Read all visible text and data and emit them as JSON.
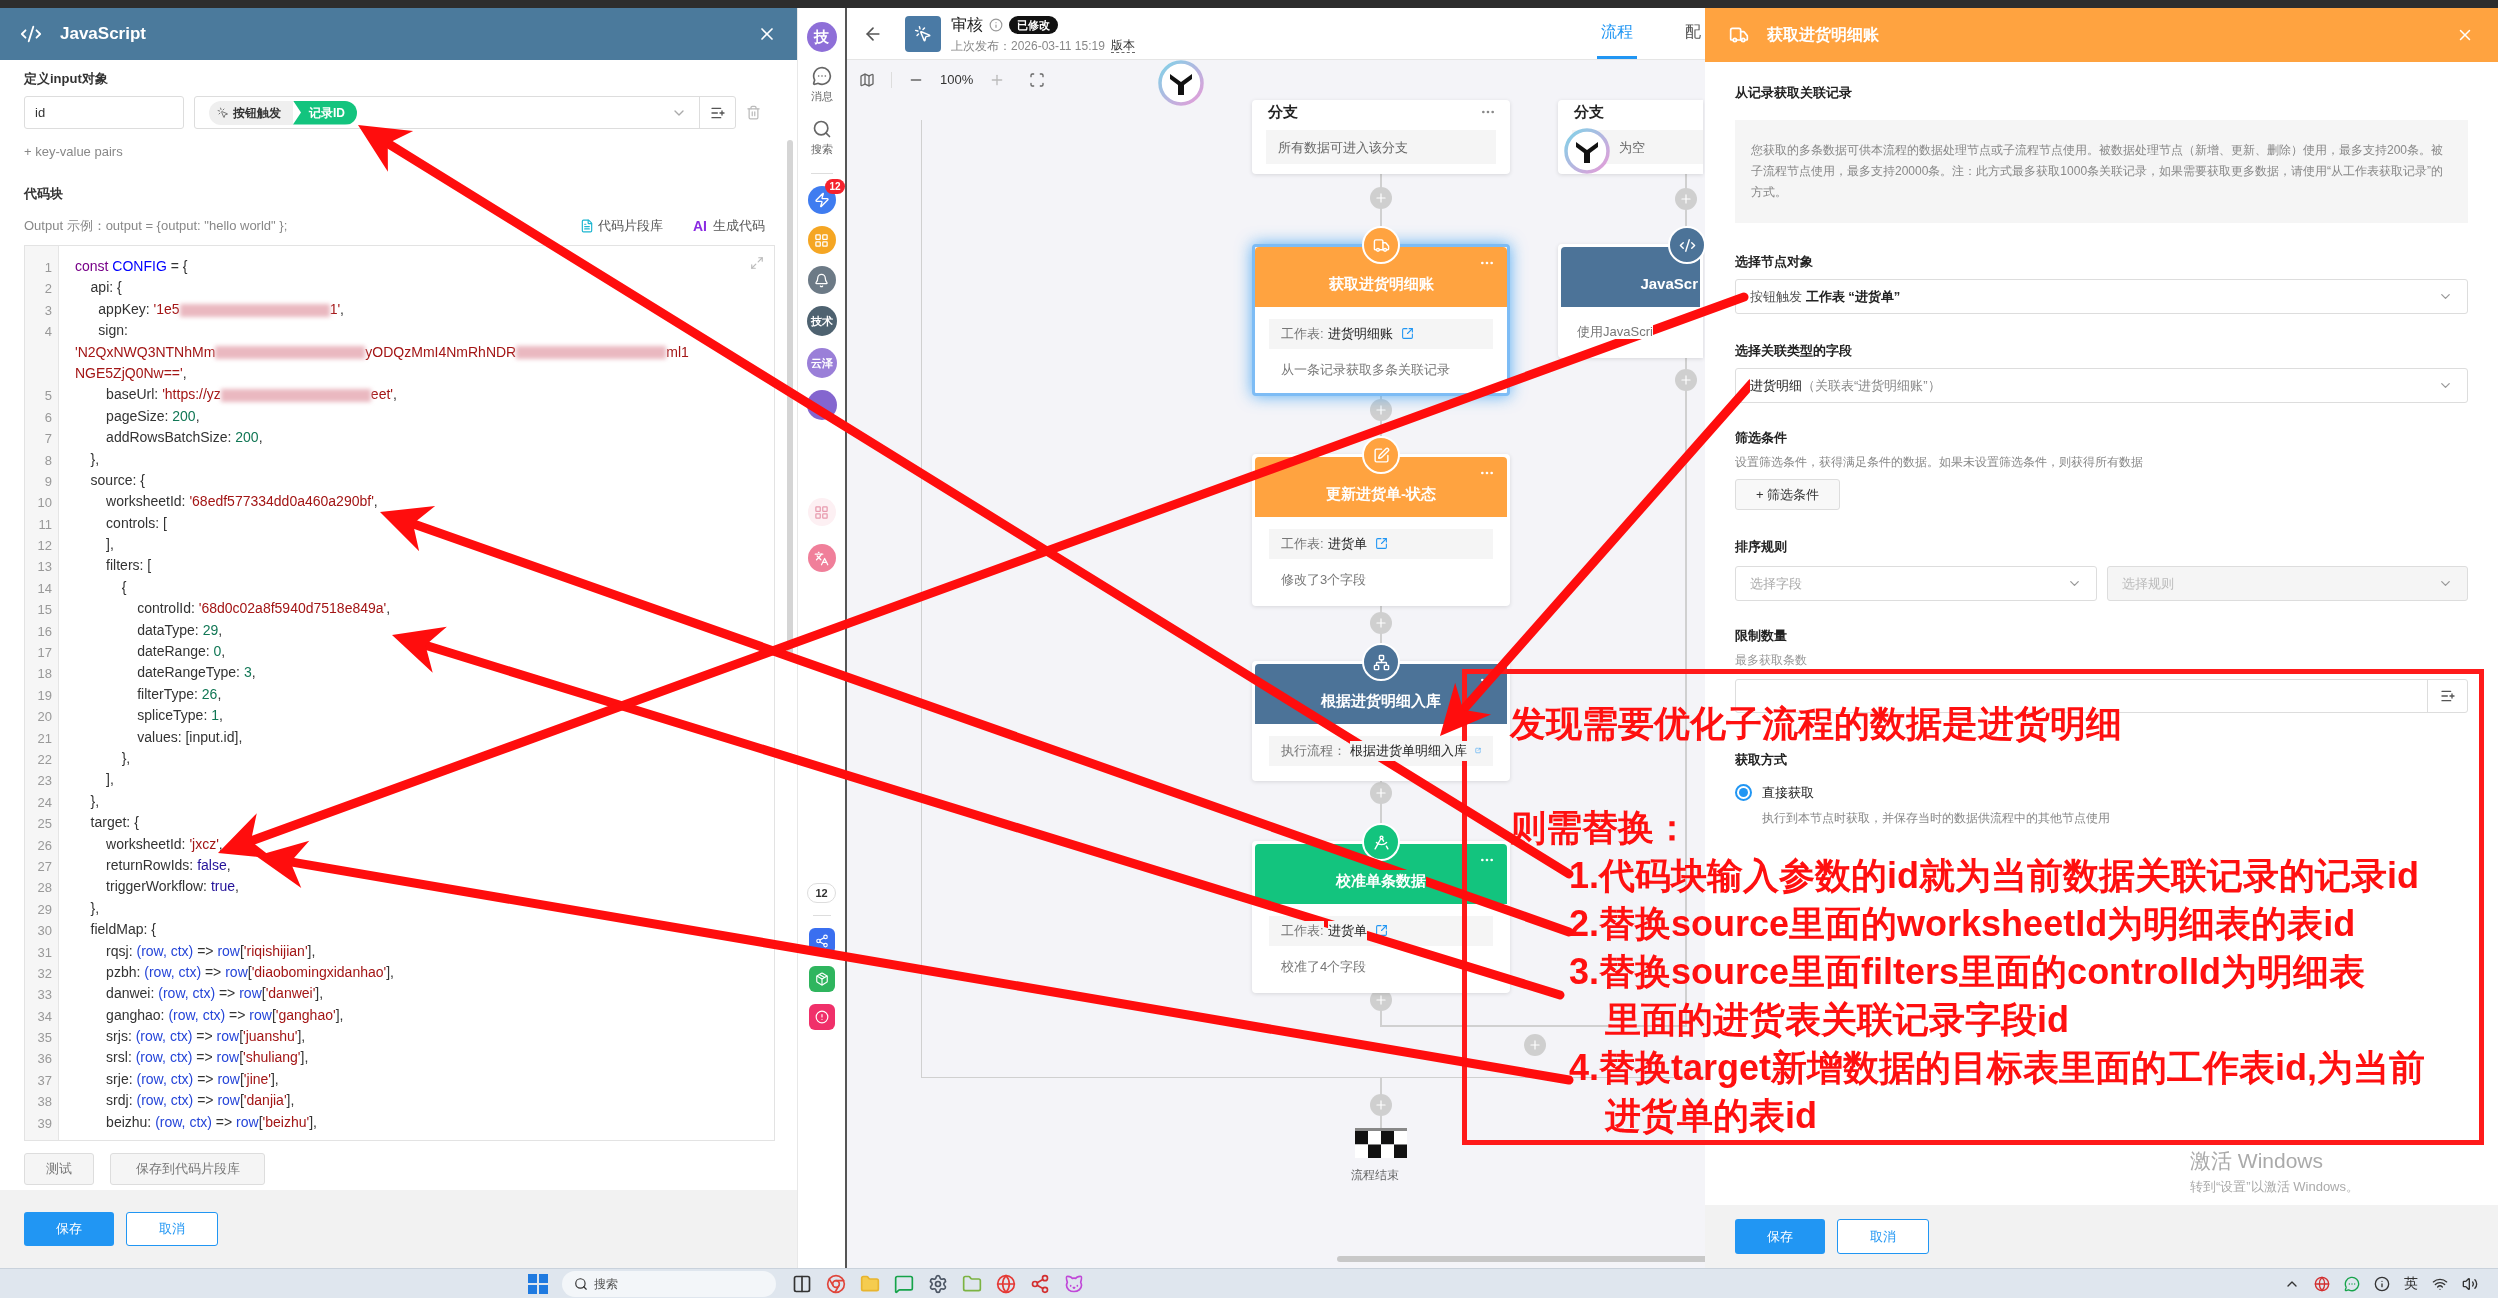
{
  "left_panel": {
    "title": "JavaScript",
    "input_label": "定义input对象",
    "input_rows": [
      {
        "key": "id",
        "tags": [
          {
            "kind": "trigger",
            "text": "按钮触发"
          },
          {
            "kind": "field",
            "text": "记录ID"
          }
        ]
      }
    ],
    "add_pairs": "+ key-value pairs",
    "code_label": "代码块",
    "output_hint": "Output 示例：output = {output: \"hello world\" };",
    "snippet_link": "代码片段库",
    "ai_badge": "AI",
    "ai_link": "生成代码",
    "code": [
      {
        "n": "1",
        "segs": [
          {
            "kind": "kw",
            "text": "const "
          },
          {
            "kind": "var",
            "text": "CONFIG"
          },
          {
            "kind": "plain",
            "text": " = {"
          }
        ]
      },
      {
        "n": "2",
        "segs": [
          {
            "kind": "plain",
            "text": "    api: {"
          }
        ]
      },
      {
        "n": "3",
        "segs": [
          {
            "kind": "plain",
            "text": "      appKey: "
          },
          {
            "kind": "str",
            "text": "'1e5"
          },
          {
            "kind": "redacted"
          },
          {
            "kind": "str",
            "text": "1'"
          },
          {
            "kind": "plain",
            "text": ","
          }
        ]
      },
      {
        "n": "4",
        "segs": [
          {
            "kind": "plain",
            "text": "      sign:"
          }
        ]
      },
      {
        "segs": [
          {
            "kind": "str",
            "text": "'N2QxNWQ3NTNhMm"
          },
          {
            "kind": "redacted"
          },
          {
            "kind": "str",
            "text": "yODQzMmI4NmRhNDR"
          },
          {
            "kind": "redacted"
          },
          {
            "kind": "str",
            "text": "ml1"
          }
        ]
      },
      {
        "segs": [
          {
            "kind": "str",
            "text": "NGE5ZjQ0Nw=='"
          },
          {
            "kind": "plain",
            "text": ","
          }
        ]
      },
      {
        "n": "5",
        "segs": [
          {
            "kind": "plain",
            "text": "        baseUrl: "
          },
          {
            "kind": "str",
            "text": "'https://yz"
          },
          {
            "kind": "redacted"
          },
          {
            "kind": "str",
            "text": "eet'"
          },
          {
            "kind": "plain",
            "text": ","
          }
        ]
      },
      {
        "n": "6",
        "segs": [
          {
            "kind": "plain",
            "text": "        pageSize: "
          },
          {
            "kind": "num",
            "text": "200"
          },
          {
            "kind": "plain",
            "text": ","
          }
        ]
      },
      {
        "n": "7",
        "segs": [
          {
            "kind": "plain",
            "text": "        addRowsBatchSize: "
          },
          {
            "kind": "num",
            "text": "200"
          },
          {
            "kind": "plain",
            "text": ","
          }
        ]
      },
      {
        "n": "8",
        "segs": [
          {
            "kind": "plain",
            "text": "    },"
          }
        ]
      },
      {
        "n": "9",
        "segs": [
          {
            "kind": "plain",
            "text": "    source: {"
          }
        ]
      },
      {
        "n": "10",
        "segs": [
          {
            "kind": "plain",
            "text": "        worksheetId: "
          },
          {
            "kind": "str",
            "text": "'68edf577334dd0a460a290bf'"
          },
          {
            "kind": "plain",
            "text": ","
          }
        ]
      },
      {
        "n": "11",
        "segs": [
          {
            "kind": "plain",
            "text": "        controls: ["
          }
        ]
      },
      {
        "n": "12",
        "segs": [
          {
            "kind": "plain",
            "text": "        ],"
          }
        ]
      },
      {
        "n": "13",
        "segs": [
          {
            "kind": "plain",
            "text": "        filters: ["
          }
        ]
      },
      {
        "n": "14",
        "segs": [
          {
            "kind": "plain",
            "text": "            {"
          }
        ]
      },
      {
        "n": "15",
        "segs": [
          {
            "kind": "plain",
            "text": "                controlId: "
          },
          {
            "kind": "str",
            "text": "'68d0c02a8f5940d7518e849a'"
          },
          {
            "kind": "plain",
            "text": ","
          }
        ]
      },
      {
        "n": "16",
        "segs": [
          {
            "kind": "plain",
            "text": "                dataType: "
          },
          {
            "kind": "num",
            "text": "29"
          },
          {
            "kind": "plain",
            "text": ","
          }
        ]
      },
      {
        "n": "17",
        "segs": [
          {
            "kind": "plain",
            "text": "                dateRange: "
          },
          {
            "kind": "num",
            "text": "0"
          },
          {
            "kind": "plain",
            "text": ","
          }
        ]
      },
      {
        "n": "18",
        "segs": [
          {
            "kind": "plain",
            "text": "                dateRangeType: "
          },
          {
            "kind": "num",
            "text": "3"
          },
          {
            "kind": "plain",
            "text": ","
          }
        ]
      },
      {
        "n": "19",
        "segs": [
          {
            "kind": "plain",
            "text": "                filterType: "
          },
          {
            "kind": "num",
            "text": "26"
          },
          {
            "kind": "plain",
            "text": ","
          }
        ]
      },
      {
        "n": "20",
        "segs": [
          {
            "kind": "plain",
            "text": "                spliceType: "
          },
          {
            "kind": "num",
            "text": "1"
          },
          {
            "kind": "plain",
            "text": ","
          }
        ]
      },
      {
        "n": "21",
        "segs": [
          {
            "kind": "plain",
            "text": "                values: [input.id],"
          }
        ]
      },
      {
        "n": "22",
        "segs": [
          {
            "kind": "plain",
            "text": "            },"
          }
        ]
      },
      {
        "n": "23",
        "segs": [
          {
            "kind": "plain",
            "text": "        ],"
          }
        ]
      },
      {
        "n": "24",
        "segs": [
          {
            "kind": "plain",
            "text": "    },"
          }
        ]
      },
      {
        "n": "25",
        "segs": [
          {
            "kind": "plain",
            "text": "    target: {"
          }
        ]
      },
      {
        "n": "26",
        "segs": [
          {
            "kind": "plain",
            "text": "        worksheetId: "
          },
          {
            "kind": "str",
            "text": "'jxcz'"
          },
          {
            "kind": "plain",
            "text": ","
          }
        ]
      },
      {
        "n": "27",
        "segs": [
          {
            "kind": "plain",
            "text": "        returnRowIds: "
          },
          {
            "kind": "bool",
            "text": "false"
          },
          {
            "kind": "plain",
            "text": ","
          }
        ]
      },
      {
        "n": "28",
        "segs": [
          {
            "kind": "plain",
            "text": "        triggerWorkflow: "
          },
          {
            "kind": "bool",
            "text": "true"
          },
          {
            "kind": "plain",
            "text": ","
          }
        ]
      },
      {
        "n": "29",
        "segs": [
          {
            "kind": "plain",
            "text": "    },"
          }
        ]
      },
      {
        "n": "30",
        "segs": [
          {
            "kind": "plain",
            "text": "    fieldMap: {"
          }
        ]
      },
      {
        "n": "31",
        "segs": [
          {
            "kind": "plain",
            "text": "        rqsj: "
          },
          {
            "kind": "param",
            "text": "(row, ctx)"
          },
          {
            "kind": "plain",
            "text": " => "
          },
          {
            "kind": "param",
            "text": "row"
          },
          {
            "kind": "plain",
            "text": "["
          },
          {
            "kind": "str",
            "text": "'riqishijian'"
          },
          {
            "kind": "plain",
            "text": "],"
          }
        ]
      },
      {
        "n": "32",
        "segs": [
          {
            "kind": "plain",
            "text": "        pzbh: "
          },
          {
            "kind": "param",
            "text": "(row, ctx)"
          },
          {
            "kind": "plain",
            "text": " => "
          },
          {
            "kind": "param",
            "text": "row"
          },
          {
            "kind": "plain",
            "text": "["
          },
          {
            "kind": "str",
            "text": "'diaobomingxidanhao'"
          },
          {
            "kind": "plain",
            "text": "],"
          }
        ]
      },
      {
        "n": "33",
        "segs": [
          {
            "kind": "plain",
            "text": "        danwei: "
          },
          {
            "kind": "param",
            "text": "(row, ctx)"
          },
          {
            "kind": "plain",
            "text": " => "
          },
          {
            "kind": "param",
            "text": "row"
          },
          {
            "kind": "plain",
            "text": "["
          },
          {
            "kind": "str",
            "text": "'danwei'"
          },
          {
            "kind": "plain",
            "text": "],"
          }
        ]
      },
      {
        "n": "34",
        "segs": [
          {
            "kind": "plain",
            "text": "        ganghao: "
          },
          {
            "kind": "param",
            "text": "(row, ctx)"
          },
          {
            "kind": "plain",
            "text": " => "
          },
          {
            "kind": "param",
            "text": "row"
          },
          {
            "kind": "plain",
            "text": "["
          },
          {
            "kind": "str",
            "text": "'ganghao'"
          },
          {
            "kind": "plain",
            "text": "],"
          }
        ]
      },
      {
        "n": "35",
        "segs": [
          {
            "kind": "plain",
            "text": "        srjs: "
          },
          {
            "kind": "param",
            "text": "(row, ctx)"
          },
          {
            "kind": "plain",
            "text": " => "
          },
          {
            "kind": "param",
            "text": "row"
          },
          {
            "kind": "plain",
            "text": "["
          },
          {
            "kind": "str",
            "text": "'juanshu'"
          },
          {
            "kind": "plain",
            "text": "],"
          }
        ]
      },
      {
        "n": "36",
        "segs": [
          {
            "kind": "plain",
            "text": "        srsl: "
          },
          {
            "kind": "param",
            "text": "(row, ctx)"
          },
          {
            "kind": "plain",
            "text": " => "
          },
          {
            "kind": "param",
            "text": "row"
          },
          {
            "kind": "plain",
            "text": "["
          },
          {
            "kind": "str",
            "text": "'shuliang'"
          },
          {
            "kind": "plain",
            "text": "],"
          }
        ]
      },
      {
        "n": "37",
        "segs": [
          {
            "kind": "plain",
            "text": "        srje: "
          },
          {
            "kind": "param",
            "text": "(row, ctx)"
          },
          {
            "kind": "plain",
            "text": " => "
          },
          {
            "kind": "param",
            "text": "row"
          },
          {
            "kind": "plain",
            "text": "["
          },
          {
            "kind": "str",
            "text": "'jine'"
          },
          {
            "kind": "plain",
            "text": "],"
          }
        ]
      },
      {
        "n": "38",
        "segs": [
          {
            "kind": "plain",
            "text": "        srdj: "
          },
          {
            "kind": "param",
            "text": "(row, ctx)"
          },
          {
            "kind": "plain",
            "text": " => "
          },
          {
            "kind": "param",
            "text": "row"
          },
          {
            "kind": "plain",
            "text": "["
          },
          {
            "kind": "str",
            "text": "'danjia'"
          },
          {
            "kind": "plain",
            "text": "],"
          }
        ]
      },
      {
        "n": "39",
        "segs": [
          {
            "kind": "plain",
            "text": "        beizhu: "
          },
          {
            "kind": "param",
            "text": "(row, ctx)"
          },
          {
            "kind": "plain",
            "text": " => "
          },
          {
            "kind": "param",
            "text": "row"
          },
          {
            "kind": "plain",
            "text": "["
          },
          {
            "kind": "str",
            "text": "'beizhu'"
          },
          {
            "kind": "plain",
            "text": "],"
          }
        ]
      }
    ],
    "test_button": "测试",
    "save_snippet_button": "保存到代码片段库",
    "save_button": "保存",
    "cancel_button": "取消"
  },
  "rail": {
    "top": [
      {
        "kind": "avatar",
        "text": "技",
        "color": "#8e6fd8"
      },
      {
        "kind": "messages",
        "text": "消息"
      },
      {
        "kind": "search",
        "text": "搜索"
      }
    ],
    "apps": [
      {
        "kind": "bolt",
        "badge": "12"
      },
      {
        "kind": "grid"
      },
      {
        "kind": "bell"
      },
      {
        "kind": "avatar",
        "text": "技术",
        "color": "#4e6270"
      },
      {
        "kind": "avatar",
        "text": "云泽",
        "color": "#9a7fd8"
      },
      {
        "kind": "avatar",
        "color": "#8466cf"
      }
    ],
    "middle": [
      {
        "kind": "widgets"
      },
      {
        "kind": "translate"
      }
    ],
    "bottom": [
      {
        "kind": "count",
        "text": "12"
      },
      {
        "kind": "share"
      },
      {
        "kind": "box"
      },
      {
        "kind": "alert"
      }
    ]
  },
  "flow": {
    "header": {
      "title": "审核",
      "badge": "已修改",
      "published": "上次发布：2026-03-11 15:19",
      "version_link": "版本",
      "tabs": [
        {
          "label": "流程",
          "selected": true
        },
        {
          "label": "配",
          "selected": false
        }
      ]
    },
    "zoom": "100%",
    "nodes": [
      {
        "kind": "branch",
        "title": "分支",
        "body": "所有数据可进入该分支"
      },
      {
        "kind": "branch",
        "title": "分支",
        "body": "为空"
      },
      {
        "kind": "fetch",
        "title": "获取进货明细账",
        "color": "#ffa340",
        "selected": true,
        "sheet_label": "工作表:",
        "sheet": "进货明细账",
        "note": "从一条记录获取多条关联记录"
      },
      {
        "kind": "update",
        "title": "更新进货单-状态",
        "color": "#ffa340",
        "selected": false,
        "sheet_label": "工作表:",
        "sheet": "进货单",
        "note": "修改了3个字段"
      },
      {
        "kind": "subprocess",
        "title": "根据进货明细入库",
        "color": "#4c7398",
        "selected": false,
        "sheet_label": "执行流程：",
        "sheet": "根据进货单明细入库"
      },
      {
        "kind": "calibrate",
        "title": "校准单条数据",
        "color": "#13c47e",
        "selected": false,
        "sheet_label": "工作表:",
        "sheet": "进货单",
        "note": "校准了4个字段"
      },
      {
        "kind": "code",
        "title": "JavaScr",
        "color": "#4c7398",
        "selected": false,
        "note": "使用JavaScri"
      }
    ],
    "end_label": "流程结束"
  },
  "right_panel": {
    "title": "获取进货明细账",
    "section": "从记录获取关联记录",
    "info": "您获取的多条数据可供本流程的数据处理节点或子流程节点使用。被数据处理节点（新增、更新、删除）使用，最多支持200条。被子流程节点使用，最多支持20000条。注：此方式最多获取1000条关联记录，如果需要获取更多数据，请使用“从工作表获取记录”的方式。",
    "node_label": "选择节点对象",
    "node_source": "按钮触发",
    "node_sheet": "工作表 “进货单”",
    "field_label": "选择关联类型的字段",
    "field_value": "进货明细",
    "field_hint": "（关联表“进货明细账”）",
    "filter_label": "筛选条件",
    "filter_desc": "设置筛选条件，获得满足条件的数据。如果未设置筛选条件，则获得所有数据",
    "filter_button": "+ 筛选条件",
    "sort_label": "排序规则",
    "sort_fields": [
      {
        "placeholder": "选择字段",
        "disabled": false
      },
      {
        "placeholder": "选择规则",
        "disabled": true
      }
    ],
    "limit_label": "限制数量",
    "limit_hint": "最多获取条数",
    "mode_label": "获取方式",
    "modes": [
      {
        "label": "直接获取",
        "selected": true,
        "desc": "执行到本节点时获取，并保存当时的数据供流程中的其他节点使用"
      }
    ],
    "save_button": "保存",
    "cancel_button": "取消"
  },
  "os_notice": {
    "title": "激活 Windows",
    "subtitle": "转到“设置”以激活 Windows。"
  },
  "annotation": {
    "heading": "发现需要优化子流程的数据是进货明细",
    "lead": "则需替换：",
    "steps": [
      {
        "lines": [
          "1.代码块输入参数的id就为当前数据关联记录的记录id"
        ]
      },
      {
        "lines": [
          "2.替换source里面的worksheetId为明细表的表id"
        ]
      },
      {
        "lines": [
          "3.替换source里面filters里面的controlId为明细表",
          "里面的进货表关联记录字段id"
        ]
      },
      {
        "lines": [
          "4.替换target新增数据的目标表里面的工作表id,为当前",
          "进货单的表id"
        ]
      }
    ]
  },
  "taskbar": {
    "search_placeholder": "搜索",
    "ime": "英"
  }
}
